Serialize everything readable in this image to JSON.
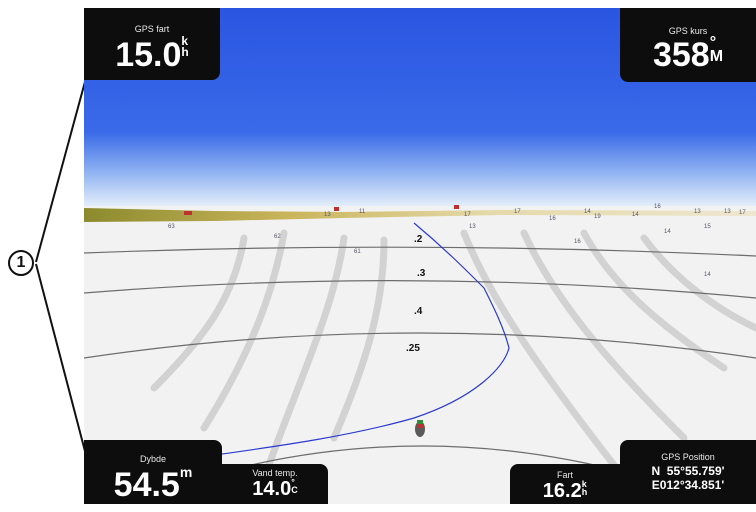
{
  "callout": {
    "number": "1"
  },
  "fields": {
    "gps_speed": {
      "label": "GPS fart",
      "value": "15.0",
      "unit_top": "k",
      "unit_bottom": "h"
    },
    "gps_course": {
      "label": "GPS kurs",
      "value": "358",
      "unit_top": "°",
      "unit_bottom": "M"
    },
    "depth": {
      "label": "Dybde",
      "value": "54.5",
      "unit": "m"
    },
    "water_temp": {
      "label": "Vand temp.",
      "value": "14.0",
      "unit_top": "°",
      "unit_bottom": "C"
    },
    "speed": {
      "label": "Fart",
      "value": "16.2",
      "unit_top": "k",
      "unit_bottom": "h"
    },
    "gps_position": {
      "label": "GPS Position",
      "lat": "N  55°55.759'",
      "lon": "E012°34.851'"
    }
  },
  "map": {
    "markers": [
      ".2",
      ".3",
      ".4",
      ".25"
    ],
    "depth_labels": [
      "63",
      "62",
      "61",
      "13",
      "11",
      "17",
      "17",
      "13",
      "14",
      "16",
      "14",
      "15",
      "14",
      "16",
      "19",
      "13",
      "13",
      "17",
      "16",
      "14"
    ]
  },
  "colors": {
    "sky": "#2a55e2",
    "panel": "#0d0d0d",
    "track": "#2b3ad0"
  }
}
